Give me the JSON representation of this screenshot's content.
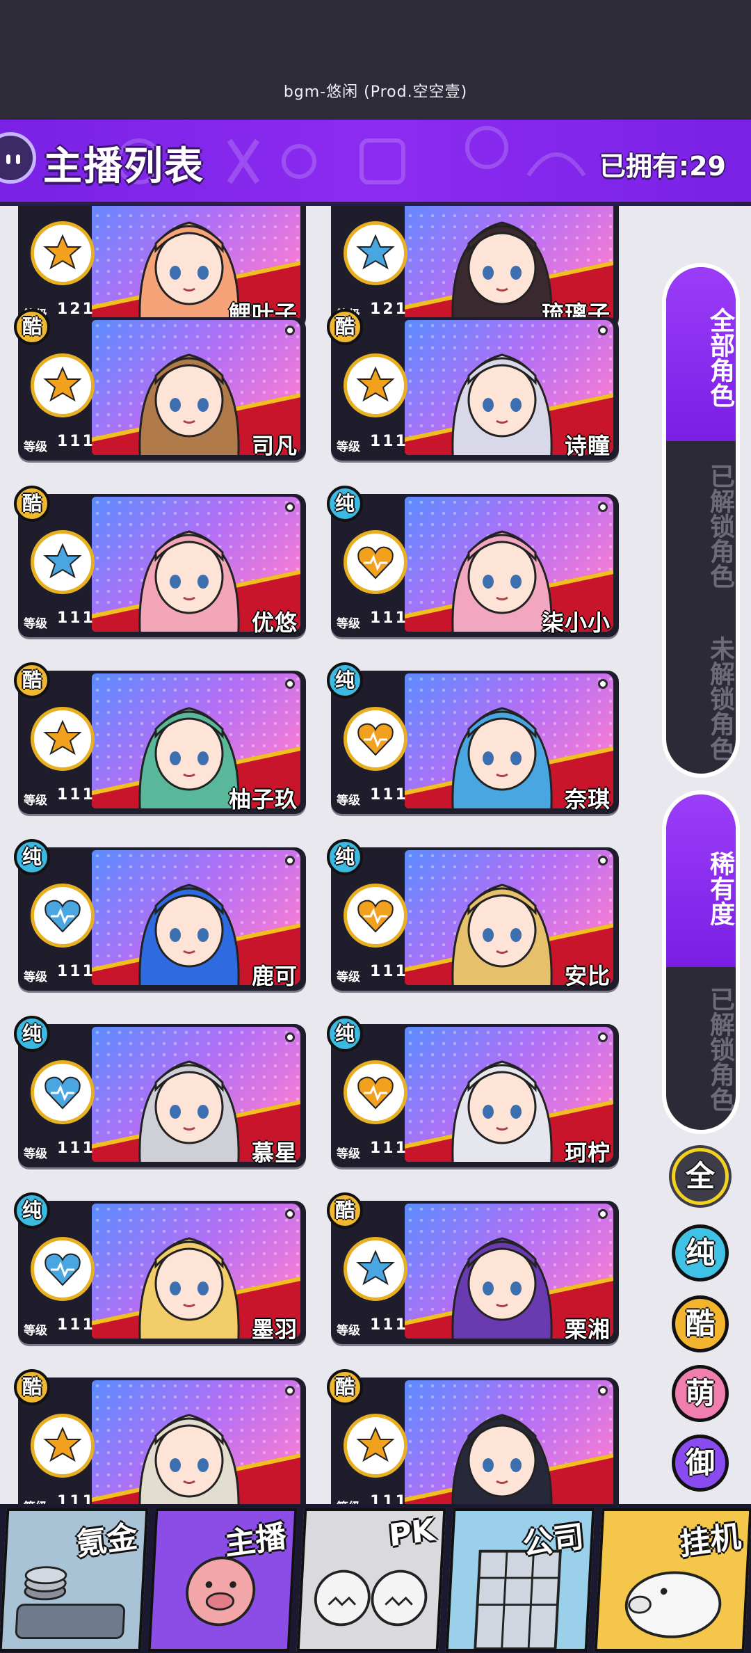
{
  "status": {
    "bgm": "bgm-悠闲 (Prod.空空壹)"
  },
  "header": {
    "title": "主播列表",
    "owned_label": "已拥有:",
    "owned_count": "29"
  },
  "level_label": "等级",
  "cards": [
    {
      "name": "鲤叶子",
      "level": "121",
      "attr": ""
    },
    {
      "name": "琉璃子",
      "level": "121",
      "attr": ""
    },
    {
      "name": "司凡",
      "level": "111",
      "attr": "酷"
    },
    {
      "name": "诗瞳",
      "level": "111",
      "attr": "酷"
    },
    {
      "name": "优悠",
      "level": "111",
      "attr": "酷"
    },
    {
      "name": "柒小小",
      "level": "111",
      "attr": "纯"
    },
    {
      "name": "柚子玖",
      "level": "111",
      "attr": "酷"
    },
    {
      "name": "奈琪",
      "level": "111",
      "attr": "纯"
    },
    {
      "name": "鹿可",
      "level": "111",
      "attr": "纯"
    },
    {
      "name": "安比",
      "level": "111",
      "attr": "纯"
    },
    {
      "name": "慕星",
      "level": "111",
      "attr": "纯"
    },
    {
      "name": "珂柠",
      "level": "111",
      "attr": "纯"
    },
    {
      "name": "墨羽",
      "level": "111",
      "attr": "纯"
    },
    {
      "name": "栗湘",
      "level": "111",
      "attr": "酷"
    },
    {
      "name": "",
      "level": "111",
      "attr": "酷"
    },
    {
      "name": "",
      "level": "111",
      "attr": "酷"
    }
  ],
  "side_filters": {
    "group1": [
      "全部角色",
      "已解锁角色",
      "未解锁角色"
    ],
    "group2": [
      "稀有度",
      "已解锁角色"
    ]
  },
  "attr_filters": [
    "全",
    "纯",
    "酷",
    "萌",
    "御"
  ],
  "bottom_nav": [
    "氪金",
    "主播",
    "PK",
    "公司",
    "挂机"
  ],
  "colors": {
    "header_purple": "#8c2cf0",
    "card_red": "#c9152b",
    "cool_gold": "#f0b830",
    "pure_blue": "#3bb9e0"
  }
}
